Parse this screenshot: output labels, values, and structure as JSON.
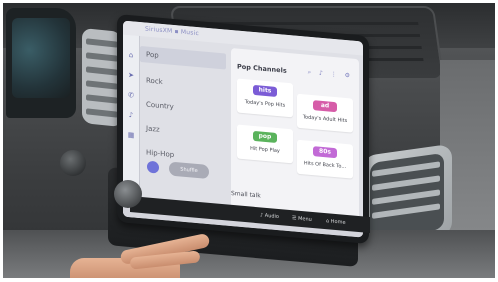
{
  "screen": {
    "search_text": "SiriusXM ▪ Music",
    "nav_items": [
      "Pop",
      "Rock",
      "Country",
      "Jazz",
      "Hip-Hop"
    ],
    "shuffle_label": "Shuffle",
    "panel_title": "Pop Channels",
    "panel_icons": "⌕ ♪ ⋮ ⚙",
    "channels": [
      {
        "logo": "hits",
        "caption": "Today's Pop Hits",
        "color": "#7b5cd6"
      },
      {
        "logo": "ad",
        "caption": "Today's Adult Hits",
        "color": "#d65ca8"
      },
      {
        "logo": "pop",
        "caption": "Hit Pop Play",
        "color": "#5ab35c"
      },
      {
        "logo": "80s",
        "caption": "Hits Of Back To...",
        "color": "#c26ad6"
      }
    ],
    "bottom_label": "Small talk"
  },
  "controls": {
    "strip_labels": [
      "♪ Audio",
      "☰ Menu",
      "⌂ Home"
    ]
  }
}
